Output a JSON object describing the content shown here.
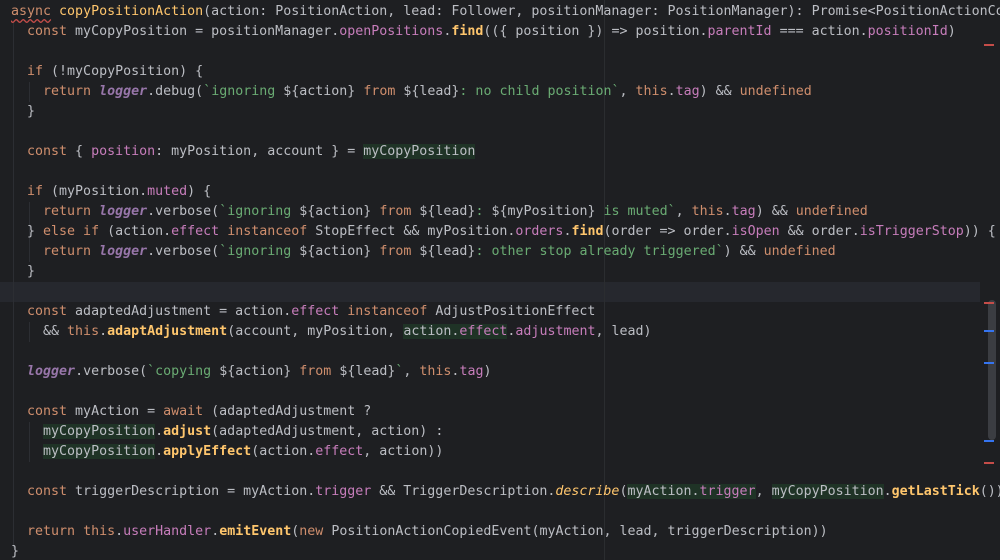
{
  "editor": {
    "lines": [
      "async copyPositionAction(action: PositionAction, lead: Follower, positionManager: PositionManager): Promise<PositionActionCopyEver",
      "  const myCopyPosition = positionManager.openPositions.find(({ position }) => position.parentId === action.positionId)",
      "",
      "  if (!myCopyPosition) {",
      "    return logger.debug(`ignoring ${action} from ${lead}: no child position`, this.tag) && undefined",
      "  }",
      "",
      "  const { position: myPosition, account } = myCopyPosition",
      "",
      "  if (myPosition.muted) {",
      "    return logger.verbose(`ignoring ${action} from ${lead}: ${myPosition} is muted`, this.tag) && undefined",
      "  } else if (action.effect instanceof StopEffect && myPosition.orders.find(order => order.isOpen && order.isTriggerStop)) {",
      "    return logger.verbose(`ignoring ${action} from ${lead}: other stop already triggered`) && undefined",
      "  }",
      "",
      "  const adaptedAdjustment = action.effect instanceof AdjustPositionEffect",
      "    && this.adaptAdjustment(account, myPosition, action.effect.adjustment, lead)",
      "",
      "  logger.verbose(`copying ${action} from ${lead}`, this.tag)",
      "",
      "  const myAction = await (adaptedAdjustment ?",
      "    myCopyPosition.adjust(adaptedAdjustment, action) :",
      "    myCopyPosition.applyEffect(action.effect, action))",
      "",
      "  const triggerDescription = myAction.trigger && TriggerDescription.describe(myAction.trigger, myCopyPosition.getLastTick())",
      "",
      "  return this.userHandler.emitEvent(new PositionActionCopiedEvent(myAction, lead, triggerDescription))",
      "}"
    ],
    "colors": {
      "background": "#1e1f22",
      "keyword": "#cf8e6d",
      "function": "#56a8f5",
      "property": "#c77dbb",
      "string": "#6aab73",
      "current_line": "#26282e"
    }
  }
}
